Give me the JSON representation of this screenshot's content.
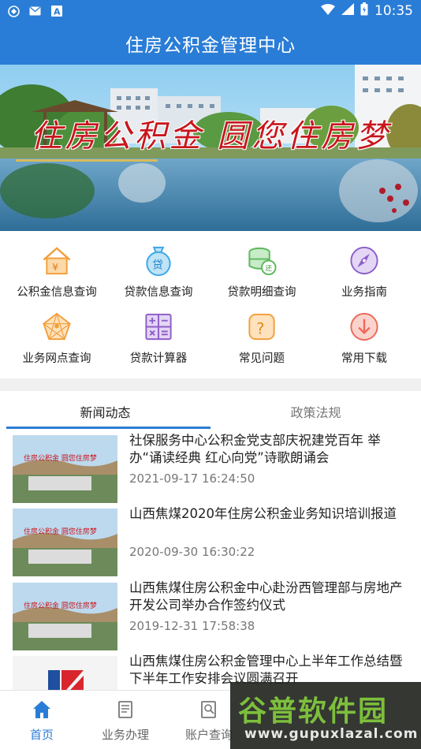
{
  "status_bar": {
    "time": "10:35",
    "left_icons": [
      "app-notify-icon",
      "mail-icon",
      "font-icon"
    ],
    "right_icons": [
      "wifi-icon",
      "signal-icon",
      "battery-icon"
    ]
  },
  "app_bar": {
    "title": "住房公积金管理中心"
  },
  "banner": {
    "slogan": "住房公积金 圆您住房梦"
  },
  "grid": {
    "items": [
      {
        "label": "公积金信息查询",
        "icon": "house-yuan-icon",
        "color": "#f2a03d"
      },
      {
        "label": "贷款信息查询",
        "icon": "money-bag-icon",
        "color": "#3ba8e8"
      },
      {
        "label": "贷款明细查询",
        "icon": "coins-icon",
        "color": "#5cb85c"
      },
      {
        "label": "业务指南",
        "icon": "compass-icon",
        "color": "#8e5fc9"
      },
      {
        "label": "业务网点查询",
        "icon": "network-icon",
        "color": "#f2a03d"
      },
      {
        "label": "贷款计算器",
        "icon": "calculator-icon",
        "color": "#8e5fc9"
      },
      {
        "label": "常见问题",
        "icon": "question-icon",
        "color": "#f2a03d"
      },
      {
        "label": "常用下载",
        "icon": "download-icon",
        "color": "#ee6a5a"
      }
    ]
  },
  "tabs": [
    {
      "label": "新闻动态",
      "active": true
    },
    {
      "label": "政策法规",
      "active": false
    }
  ],
  "news": [
    {
      "title": "社保服务中心公积金党支部庆祝建党百年 举办“诵读经典 红心向党”诗歌朗诵会",
      "date": "2021-09-17 16:24:50"
    },
    {
      "title": "山西焦煤2020年住房公积金业务知识培训报道",
      "date": "2020-09-30 16:30:22"
    },
    {
      "title": "山西焦煤住房公积金中心赴汾西管理部与房地产开发公司举办合作签约仪式",
      "date": "2019-12-31 17:58:38"
    },
    {
      "title": "山西焦煤住房公积金管理中心上半年工作总结暨下半年工作安排会议圆满召开",
      "date": ""
    }
  ],
  "bottom_nav": [
    {
      "label": "首页",
      "icon": "home-icon",
      "active": true
    },
    {
      "label": "业务办理",
      "icon": "document-icon",
      "active": false
    },
    {
      "label": "账户查询",
      "icon": "account-search-icon",
      "active": false
    }
  ],
  "watermark": {
    "title": "谷普软件园",
    "url": "www.gupuxlazal.com"
  },
  "colors": {
    "primary": "#2a7dd6",
    "divider": "#f0f0f0"
  }
}
